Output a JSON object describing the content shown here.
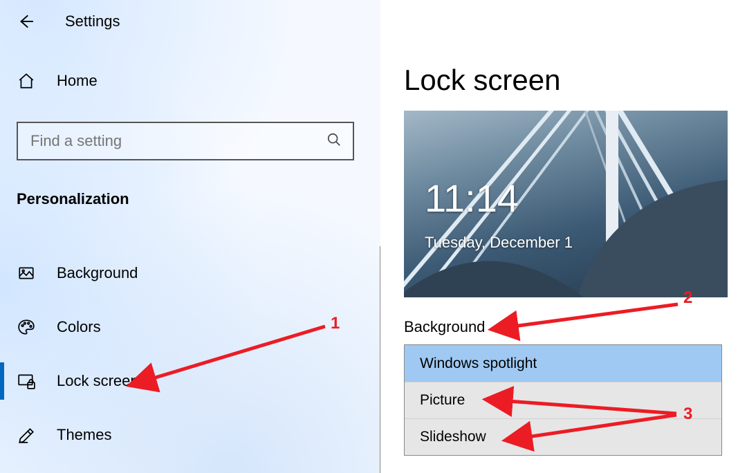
{
  "header": {
    "app_title": "Settings"
  },
  "sidebar": {
    "home_label": "Home",
    "search_placeholder": "Find a setting",
    "category": "Personalization",
    "items": [
      {
        "label": "Background",
        "icon": "picture-icon",
        "selected": false
      },
      {
        "label": "Colors",
        "icon": "palette-icon",
        "selected": false
      },
      {
        "label": "Lock screen",
        "icon": "lockscreen-icon",
        "selected": true
      },
      {
        "label": "Themes",
        "icon": "pencil-icon",
        "selected": false
      }
    ]
  },
  "main": {
    "title": "Lock screen",
    "preview": {
      "time": "11:14",
      "date": "Tuesday, December 1"
    },
    "background": {
      "label": "Background",
      "options": [
        {
          "label": "Windows spotlight",
          "selected": true
        },
        {
          "label": "Picture",
          "selected": false
        },
        {
          "label": "Slideshow",
          "selected": false
        }
      ]
    }
  },
  "annotations": {
    "1": "1",
    "2": "2",
    "3": "3"
  },
  "colors": {
    "accent": "#0067c0",
    "annotation": "#ec1c24"
  }
}
